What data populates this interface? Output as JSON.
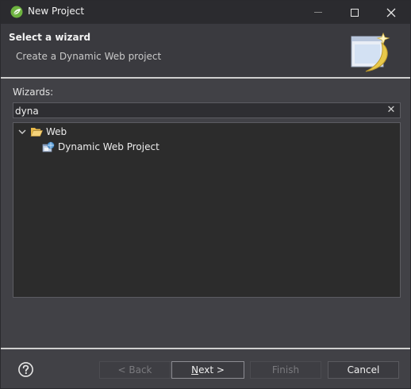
{
  "window": {
    "title": "New Project",
    "app_icon": "spring-leaf-icon"
  },
  "banner": {
    "title": "Select a wizard",
    "description": "Create a Dynamic Web project",
    "image": "wizard-banner-icon"
  },
  "wizards": {
    "label": "Wizards:",
    "filter_value": "dyna",
    "tree": [
      {
        "label": "Web",
        "icon": "folder-open-icon",
        "expanded": true,
        "children": [
          {
            "label": "Dynamic Web Project",
            "icon": "web-project-icon"
          }
        ]
      }
    ]
  },
  "buttons": {
    "back": "< Back",
    "next_prefix": "",
    "next_mnemonic": "N",
    "next_suffix": "ext >",
    "finish": "Finish",
    "cancel": "Cancel"
  },
  "colors": {
    "background": "#414146",
    "titlebar": "#2b2b2f",
    "tree_background": "#2c2c2c",
    "accent_leaf": "#6db33f"
  }
}
